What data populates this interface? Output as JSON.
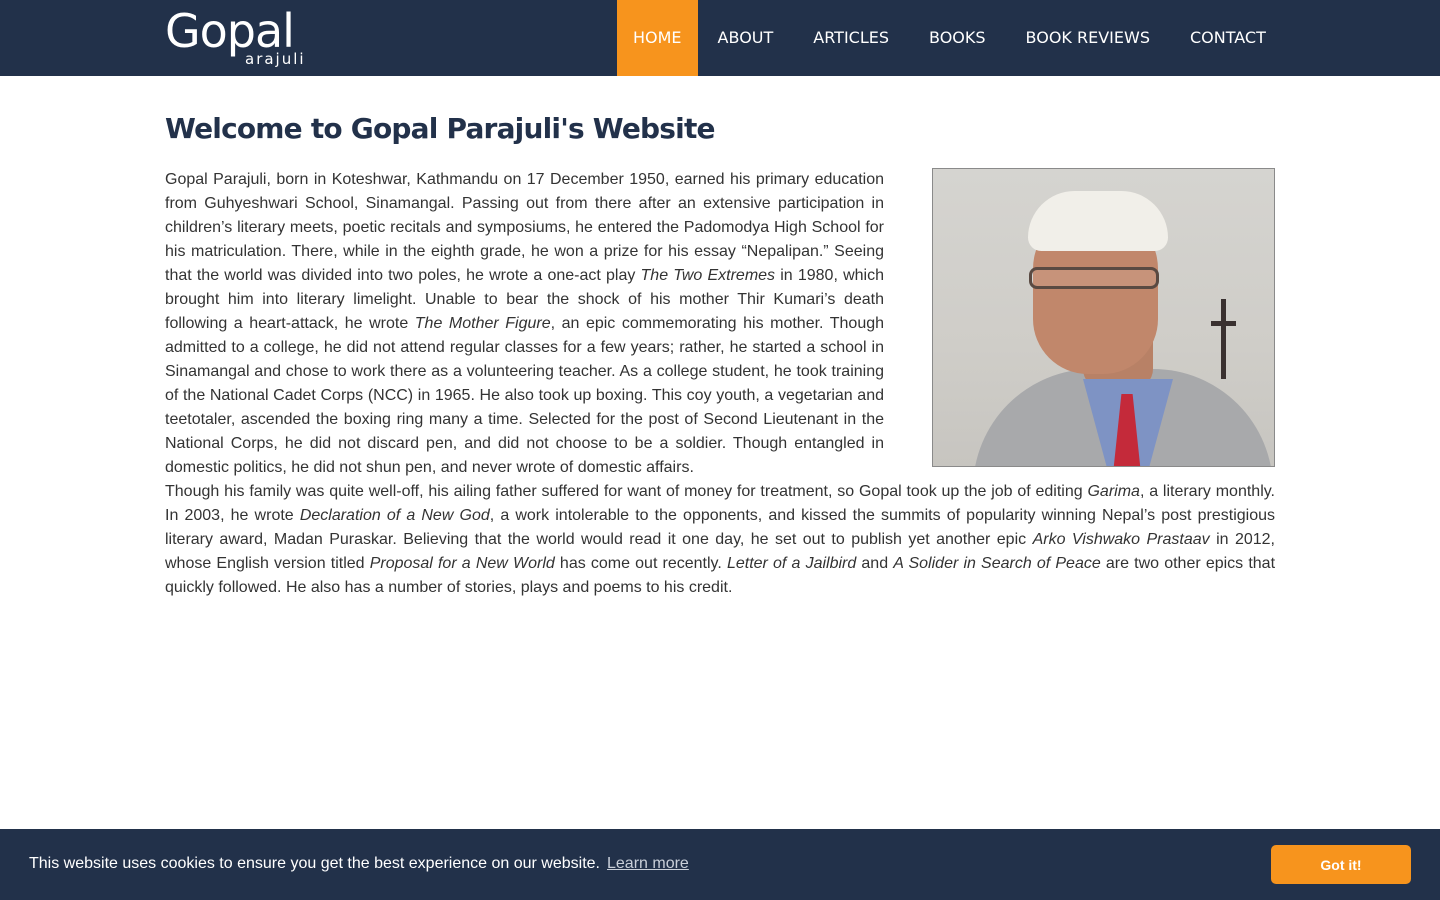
{
  "header": {
    "logo_main": "Gopal",
    "logo_sub": "arajuli",
    "nav": [
      {
        "label": "HOME",
        "active": true
      },
      {
        "label": "ABOUT",
        "active": false
      },
      {
        "label": "ARTICLES",
        "active": false
      },
      {
        "label": "BOOKS",
        "active": false
      },
      {
        "label": "BOOK REVIEWS",
        "active": false
      },
      {
        "label": "CONTACT",
        "active": false
      }
    ]
  },
  "main": {
    "title": "Welcome to Gopal Parajuli's Website",
    "article": {
      "p1_a": "Gopal Parajuli, born in Koteshwar, Kathmandu on 17 December 1950, earned his primary education from Guhyeshwari School, Sinamangal. Passing out from there after an extensive participation in children’s literary meets, poetic recitals and symposiums, he entered the Padomodya High School for his matriculation. There, while in the eighth grade, he won a prize for his essay “Nepalipan.” Seeing that the world was divided into two poles, he wrote a one-act play ",
      "p1_em1": "The Two Extremes",
      "p1_b": " in 1980, which brought him into literary limelight. Unable to bear the shock of his mother Thir Kumari’s death following a heart-attack, he wrote ",
      "p1_em2": "The Mother Figure",
      "p1_c": ", an epic commemorating his mother. Though admitted to a college, he did not attend regular classes for a few years; rather, he started a school in Sinamangal and chose to work there as a volunteering teacher. As a college student, he took training of the National Cadet Corps (NCC) in 1965. He also took up boxing. This coy youth, a vegetarian and teetotaler, ascended the boxing ring many a time. Selected for the post of Second Lieutenant in the National Corps, he did not discard pen, and did not choose to be a soldier. Though entangled in domestic politics, he did not shun pen, and never wrote of domestic affairs.",
      "p2_a": "Though his family was quite well-off, his ailing father suffered for want of money for treatment, so Gopal took up the job of editing ",
      "p2_em1": "Garima",
      "p2_b": ", a literary monthly. In 2003, he wrote ",
      "p2_em2": "Declaration of a New God",
      "p2_c": ", a work intolerable to the opponents, and kissed the summits of popularity winning Nepal’s post prestigious literary award, Madan Puraskar. Believing that the world would read it one day, he set out to publish yet another epic ",
      "p2_em3": "Arko Vishwako Prastaav",
      "p2_d": " in 2012, whose English version titled ",
      "p2_em4": "Proposal for a New World",
      "p2_e": " has come out recently. ",
      "p2_em5": "Letter of a Jailbird",
      "p2_f": " and ",
      "p2_em6": "A Solider in Search of Peace",
      "p2_g": " are two other epics that quickly followed. He also has a number of stories, plays and poems to his credit."
    }
  },
  "cookie": {
    "message": "This website uses cookies to ensure you get the best experience on our website.",
    "learn_more": "Learn more",
    "button": "Got it!"
  },
  "colors": {
    "navy": "#22314a",
    "accent_orange": "#f7941d"
  }
}
